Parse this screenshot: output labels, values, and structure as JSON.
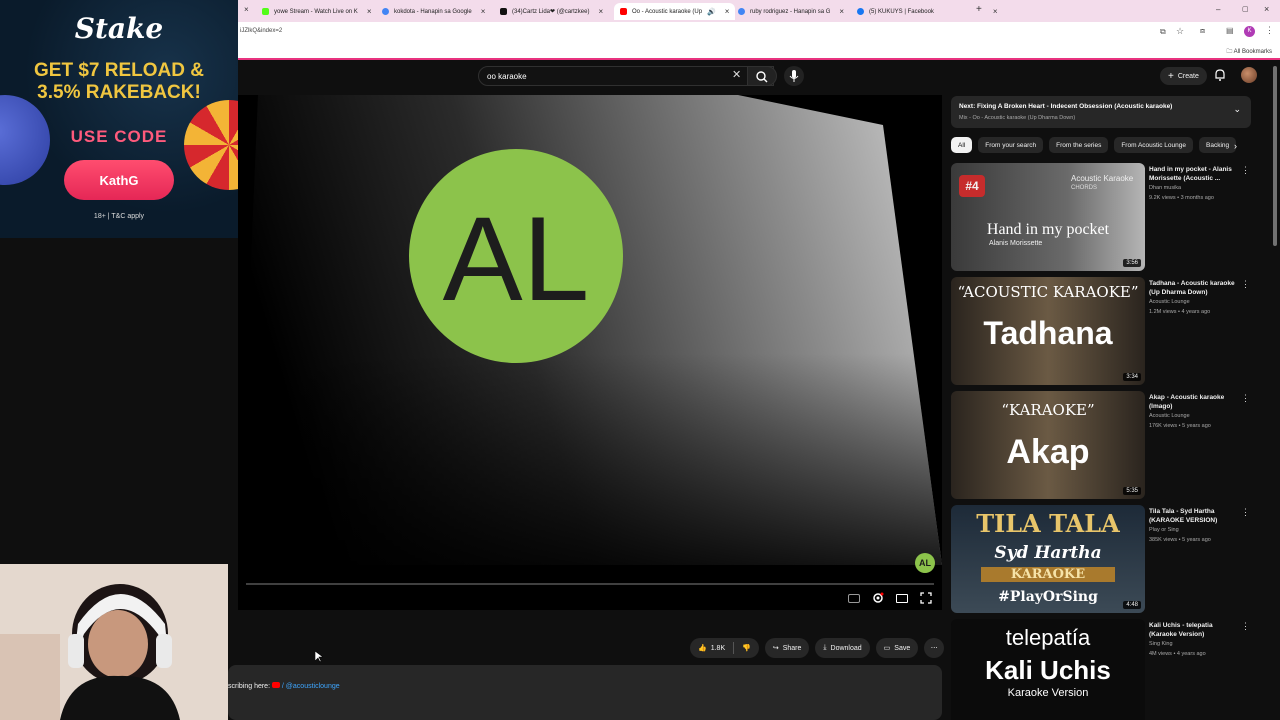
{
  "browser": {
    "tabs": [
      {
        "label": "yowe Stream - Watch Live on K",
        "color": "#53fc18"
      },
      {
        "label": "kokdota - Hanapin sa Google",
        "color": "#4285f4"
      },
      {
        "label": "(34)Cartz Lida❤ (@cartzkee)",
        "color": "#111111"
      },
      {
        "label": "Oo - Acoustic karaoke (Up",
        "color": "#ff0000"
      },
      {
        "label": "ruby rodriguez - Hanapin sa G",
        "color": "#4285f4"
      },
      {
        "label": "(5) KUKUYS | Facebook",
        "color": "#1877f2"
      }
    ],
    "url": "iJZlkQ&index=2",
    "bookmarks_label": "All Bookmarks"
  },
  "header": {
    "search_value": "oo karaoke",
    "create_label": "Create"
  },
  "ad": {
    "logo": "Stake",
    "line1": "GET $7 RELOAD &",
    "line2": "3.5% RAKEBACK!",
    "use_code": "USE CODE",
    "code": "KathG",
    "terms": "18+ | T&C apply"
  },
  "video": {
    "watermark": "AL",
    "logo_text": "AL",
    "accent": "#8cc34b"
  },
  "actions": {
    "likes": "1.8K",
    "share": "Share",
    "download": "Download",
    "save": "Save"
  },
  "description": {
    "prefix": "scribing here: ",
    "link": "/ @acousticlounge"
  },
  "next": {
    "title": "Next: Fixing A Broken Heart - Indecent Obsession (Acoustic karaoke)",
    "sub": "Mix - Oo - Acoustic karaoke (Up Dharma Down)"
  },
  "chips": [
    "All",
    "From your search",
    "From the series",
    "From Acoustic Lounge",
    "Backing"
  ],
  "related": [
    {
      "title": "Hand in my pocket - Alanis Morissette (Acoustic ...",
      "channel": "Dhan musika",
      "meta": "9.2K views • 3 months ago",
      "duration": "3:56",
      "thumb": {
        "rank": "#4",
        "top": "Acoustic Karaoke",
        "top2": "CHORDS",
        "main": "Hand in my pocket",
        "sub": "Alanis Morissette"
      }
    },
    {
      "title": "Tadhana - Acoustic karaoke (Up Dharma Down)",
      "channel": "Acoustic Lounge",
      "meta": "1.2M views • 4 years ago",
      "duration": "3:34",
      "thumb": {
        "top": "“ACOUSTIC KARAOKE”",
        "main": "Tadhana"
      }
    },
    {
      "title": "Akap - Acoustic karaoke (Imago)",
      "channel": "Acoustic Lounge",
      "meta": "176K views • 5 years ago",
      "duration": "5:35",
      "thumb": {
        "top": "“KARAOKE”",
        "main": "Akap"
      }
    },
    {
      "title": "Tila Tala - Syd Hartha (KARAOKE VERSION)",
      "channel": "Play or Sing",
      "meta": "385K views • 5 years ago",
      "duration": "4:48",
      "thumb": {
        "top": "TILA TALA",
        "main": "Syd Hartha",
        "band": "KARAOKE",
        "sub": "#PlayOrSing"
      }
    },
    {
      "title": "Kali Uchis - telepatia (Karaoke Version)",
      "channel": "Sing King",
      "meta": "4M views • 4 years ago",
      "duration": "",
      "thumb": {
        "top": "telepatía",
        "main": "Kali Uchis",
        "sub": "Karaoke Version"
      }
    }
  ]
}
